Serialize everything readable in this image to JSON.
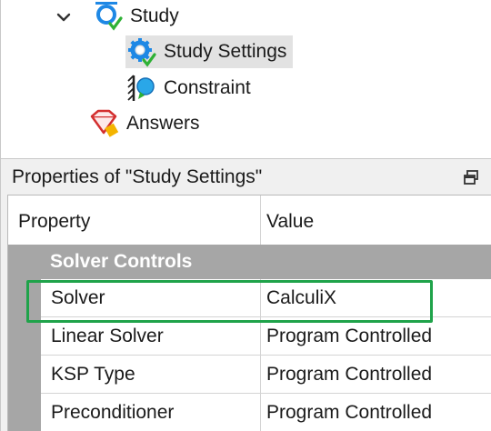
{
  "tree": {
    "items": [
      {
        "label": "Study",
        "icon": "study-icon",
        "expanded": true
      },
      {
        "label": "Study Settings",
        "icon": "study-settings-icon",
        "selected": true
      },
      {
        "label": "Constraint",
        "icon": "constraint-icon"
      },
      {
        "label": "Answers",
        "icon": "answers-icon"
      }
    ]
  },
  "properties": {
    "title": "Properties of \"Study Settings\"",
    "columns": {
      "property": "Property",
      "value": "Value"
    },
    "category": "Solver Controls",
    "rows": [
      {
        "name": "Solver",
        "value": "CalculiX",
        "highlighted": true
      },
      {
        "name": "Linear Solver",
        "value": "Program Controlled"
      },
      {
        "name": "KSP Type",
        "value": "Program Controlled"
      },
      {
        "name": "Preconditioner",
        "value": "Program Controlled"
      }
    ]
  },
  "colors": {
    "highlight_border": "#1fa34a",
    "selected_row": "#e2e2e2",
    "category_bg": "#a6a6a6",
    "icon_blue": "#1e88e5",
    "icon_green": "#2eb135"
  }
}
